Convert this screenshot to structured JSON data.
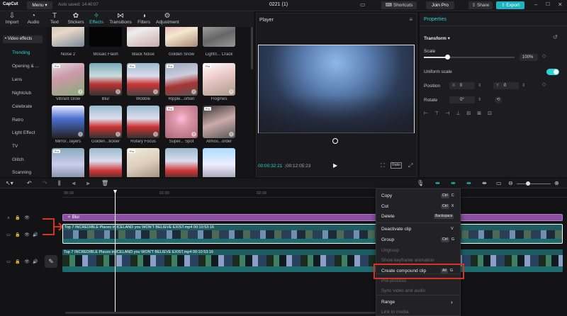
{
  "app": {
    "logo": "CapCut",
    "menu": "Menu",
    "autosave": "Auto saved: 14:40:07",
    "project_title": "0221 (1)",
    "shortcuts": "Shortcuts",
    "join_pro": "Join Pro",
    "share": "Share",
    "export": "Export"
  },
  "toolbar": {
    "items": [
      "Import",
      "Audio",
      "Text",
      "Stickers",
      "Effects",
      "Transitions",
      "Filters",
      "Adjustment"
    ]
  },
  "sidebar": {
    "header": "• Video effects",
    "items": [
      "Trending",
      "Opening & ...",
      "Lens",
      "Nightclub",
      "Celebrate",
      "Retro",
      "Light Effect",
      "TV",
      "Glitch",
      "Scanning"
    ]
  },
  "effects": {
    "row1": [
      "Noise 2",
      "Mosaic Flash",
      "Black Noise",
      "Golden Snow",
      "Lightri... Crack"
    ],
    "row2": [
      "Vibrant Glow",
      "Blur",
      "Wobble",
      "Ripple...ortion",
      "Flogmes"
    ],
    "row3": [
      "Mirror...layers",
      "Golden...tickler",
      "Rotary Focus",
      "Super... Spot",
      "Atmos...order"
    ]
  },
  "player": {
    "title": "Player",
    "current_time": "00:00:32:21",
    "total_time": "00:12:05:23",
    "ratio": "Ratio"
  },
  "properties": {
    "title": "Properties",
    "transform": "Transform",
    "scale_label": "Scale",
    "scale_value": "100%",
    "scale_fraction": 0.26,
    "uniform_scale": "Uniform scale",
    "position_label": "Position",
    "pos_x_label": "X",
    "pos_x": "0",
    "pos_y_label": "Y",
    "pos_y": "0",
    "rotate_label": "Rotate",
    "rotate_value": "0°",
    "accent": "#2ad3d8"
  },
  "timeline": {
    "ruler": [
      "00:00",
      "01:00",
      "02:00"
    ],
    "effect_clip": "Blur",
    "clip1": "Top 7 INCREDIBLE Places in ICELAND you WON'T BELIEVE EXIST.mp4   00:10:53:16",
    "clip2": "Top 7 INCREDIBLE Places in ICELAND you WON'T BELIEVE EXIST.mp4   00:10:53:16"
  },
  "context_menu": {
    "items": [
      {
        "label": "Copy",
        "key1": "Ctrl",
        "key2": "C",
        "enabled": true
      },
      {
        "label": "Cut",
        "key1": "Ctrl",
        "key2": "X",
        "enabled": true
      },
      {
        "label": "Delete",
        "key1": "",
        "key2": "Backspace",
        "enabled": true
      },
      {
        "label": "Deactivate clip",
        "key1": "",
        "key2": "V",
        "enabled": true
      },
      {
        "label": "Group",
        "key1": "Ctrl",
        "key2": "G",
        "enabled": true
      },
      {
        "label": "Ungroup",
        "key1": "",
        "key2": "",
        "enabled": false
      },
      {
        "label": "Show keyframe animation",
        "key1": "",
        "key2": "",
        "enabled": false
      },
      {
        "label": "Create compound clip",
        "key1": "Alt",
        "key2": "G",
        "enabled": true
      },
      {
        "label": "Pre-process",
        "key1": "",
        "key2": "",
        "enabled": false
      },
      {
        "label": "Sync video and audio",
        "key1": "",
        "key2": "",
        "enabled": false
      },
      {
        "label": "Range",
        "key1": "",
        "key2": "›",
        "enabled": true
      },
      {
        "label": "Link to media",
        "key1": "",
        "key2": "",
        "enabled": false
      }
    ],
    "highlight_color": "#d9331f"
  }
}
